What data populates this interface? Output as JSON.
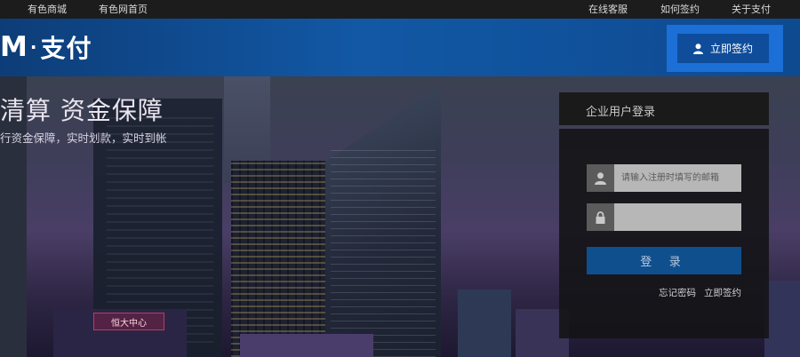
{
  "topbar": {
    "left_links": [
      "有色商城",
      "有色网首页"
    ],
    "right_links": [
      "在线客服",
      "如何签约",
      "关于支付"
    ]
  },
  "header": {
    "logo_mark": "M",
    "logo_sep": "·",
    "logo_text": "支付",
    "sign_button_label": "立即签约",
    "sign_button_icon": "user-icon"
  },
  "hero": {
    "slogan": "清算 资金保障",
    "subslogan": "行资金保障，实时划款，实时到帐",
    "neon_sign": "恒大中心"
  },
  "login": {
    "title": "企业用户登录",
    "email_placeholder": "请输入注册时填写的邮箱",
    "password_placeholder": "",
    "submit_label": "登 录",
    "forgot_link": "忘记密码",
    "signup_link": "立即签约"
  },
  "colors": {
    "header_blue": "#1258a5",
    "sign_highlight": "#1b6fd6",
    "login_button": "#0f4f8e"
  }
}
